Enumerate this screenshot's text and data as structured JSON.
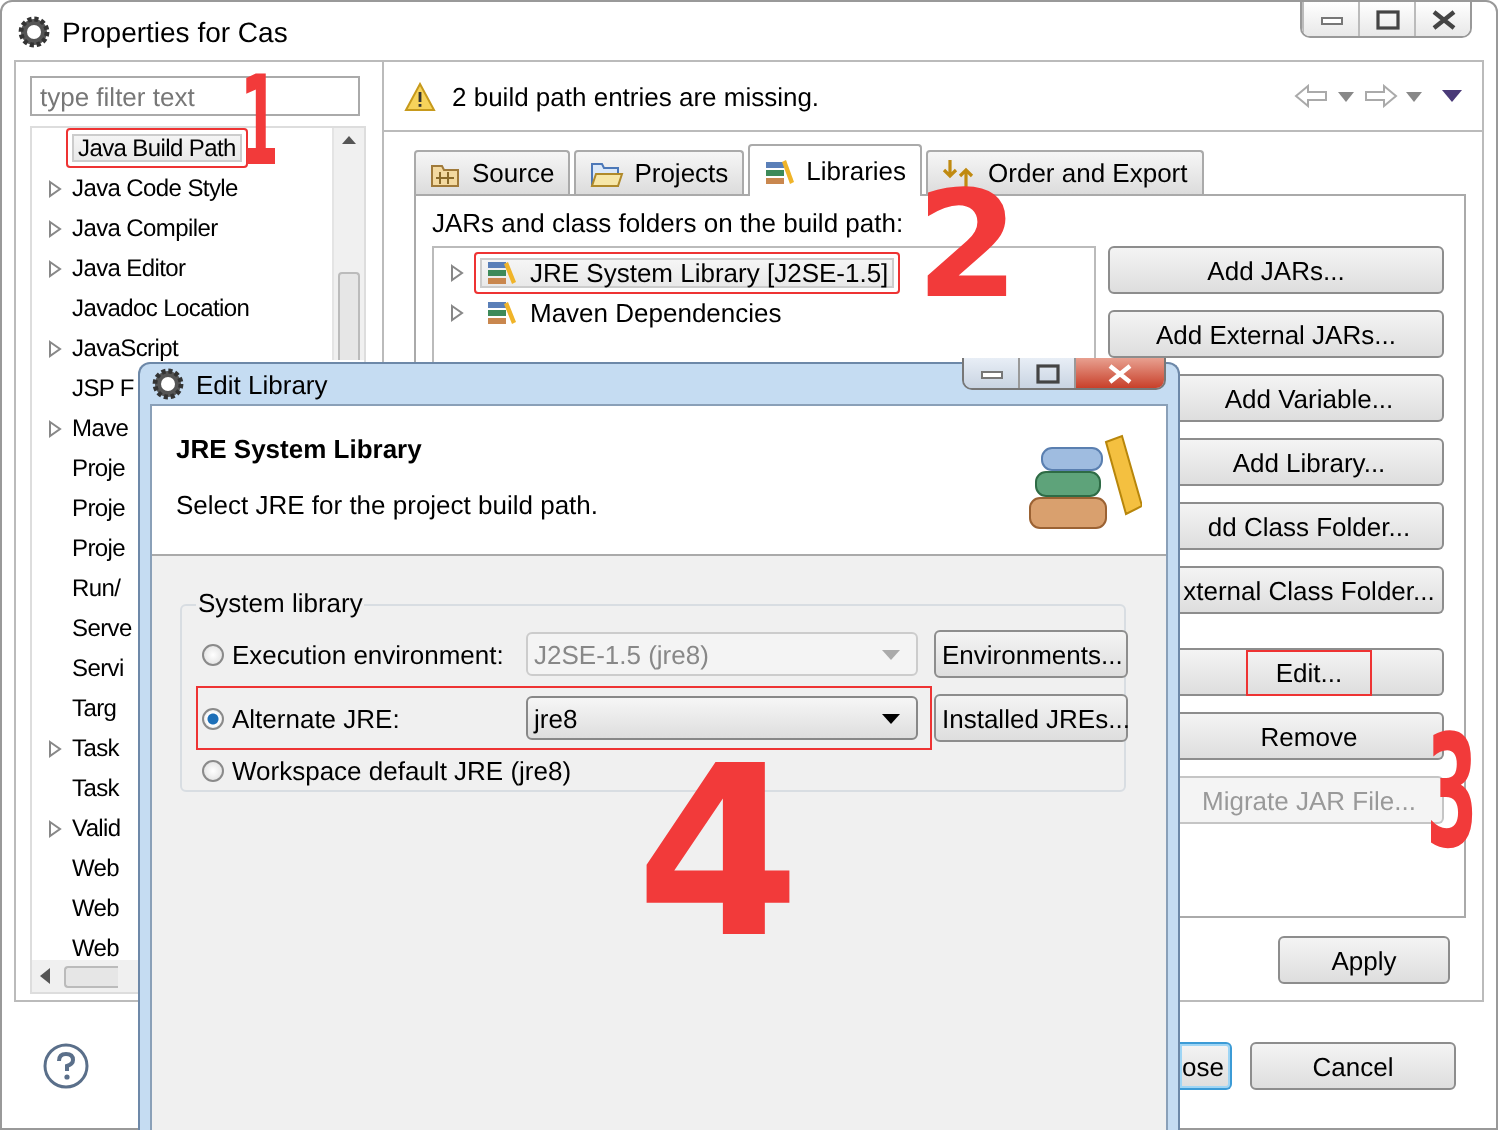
{
  "window": {
    "title": "Properties for Cas"
  },
  "sidebar": {
    "filter": {
      "placeholder": "type filter text"
    },
    "items": [
      {
        "label": "Java Build Path",
        "selected": true,
        "expandable": false,
        "highlighted": true
      },
      {
        "label": "Java Code Style",
        "selected": false,
        "expandable": true,
        "highlighted": false
      },
      {
        "label": "Java Compiler",
        "selected": false,
        "expandable": true,
        "highlighted": false
      },
      {
        "label": "Java Editor",
        "selected": false,
        "expandable": true,
        "highlighted": false
      },
      {
        "label": "Javadoc Location",
        "selected": false,
        "expandable": false,
        "highlighted": false
      },
      {
        "label": "JavaScript",
        "selected": false,
        "expandable": true,
        "highlighted": false
      },
      {
        "label": "JSP F",
        "selected": false,
        "expandable": false,
        "highlighted": false
      },
      {
        "label": "Mave",
        "selected": false,
        "expandable": true,
        "highlighted": false
      },
      {
        "label": "Proje",
        "selected": false,
        "expandable": false,
        "highlighted": false
      },
      {
        "label": "Proje",
        "selected": false,
        "expandable": false,
        "highlighted": false
      },
      {
        "label": "Proje",
        "selected": false,
        "expandable": false,
        "highlighted": false
      },
      {
        "label": "Run/",
        "selected": false,
        "expandable": false,
        "highlighted": false
      },
      {
        "label": "Serve",
        "selected": false,
        "expandable": false,
        "highlighted": false
      },
      {
        "label": "Servi",
        "selected": false,
        "expandable": false,
        "highlighted": false
      },
      {
        "label": "Targ",
        "selected": false,
        "expandable": false,
        "highlighted": false
      },
      {
        "label": "Task",
        "selected": false,
        "expandable": true,
        "highlighted": false
      },
      {
        "label": "Task",
        "selected": false,
        "expandable": false,
        "highlighted": false
      },
      {
        "label": "Valid",
        "selected": false,
        "expandable": true,
        "highlighted": false
      },
      {
        "label": "Web",
        "selected": false,
        "expandable": false,
        "highlighted": false
      },
      {
        "label": "Web",
        "selected": false,
        "expandable": false,
        "highlighted": false
      },
      {
        "label": "Web",
        "selected": false,
        "expandable": false,
        "highlighted": false
      }
    ]
  },
  "message": {
    "kind": "warning",
    "text": "2 build path entries are missing."
  },
  "tabs": [
    {
      "label": "Source",
      "kind": "source",
      "selected": false
    },
    {
      "label": "Projects",
      "kind": "projects",
      "selected": false
    },
    {
      "label": "Libraries",
      "kind": "libraries",
      "selected": true
    },
    {
      "label": "Order and Export",
      "kind": "order",
      "selected": false
    }
  ],
  "build_path": {
    "label": "JARs and class folders on the build path:",
    "entries": [
      {
        "label": "JRE System Library [J2SE-1.5]",
        "selected": true,
        "highlighted": true
      },
      {
        "label": "Maven Dependencies",
        "selected": false,
        "highlighted": false
      }
    ],
    "buttons": [
      {
        "label": "Add JARs...",
        "disabled": false,
        "highlighted": false
      },
      {
        "label": "Add External JARs...",
        "disabled": false,
        "highlighted": false
      },
      {
        "label": "Add Variable...",
        "disabled": false,
        "highlighted": false
      },
      {
        "label": "Add Library...",
        "disabled": false,
        "highlighted": false
      },
      {
        "label": "dd Class Folder...",
        "disabled": false,
        "highlighted": false
      },
      {
        "label": "xternal Class Folder...",
        "disabled": false,
        "highlighted": false
      },
      {
        "label": "Edit...",
        "disabled": false,
        "highlighted": true
      },
      {
        "label": "Remove",
        "disabled": false,
        "highlighted": false
      },
      {
        "label": "Migrate JAR File...",
        "disabled": true,
        "highlighted": false
      }
    ]
  },
  "apply_button": "Apply",
  "footer_buttons": [
    {
      "label": "ose",
      "default": true
    },
    {
      "label": "Cancel",
      "default": false
    }
  ],
  "dialog": {
    "title": "Edit Library",
    "heading": "JRE System Library",
    "description": "Select JRE for the project build path.",
    "group": {
      "title": "System library",
      "options": [
        {
          "kind": "combo",
          "label": "Execution environment:",
          "selected": false,
          "value": "J2SE-1.5 (jre8)",
          "disabled": true,
          "button": "Environments...",
          "highlighted": false
        },
        {
          "kind": "combo",
          "label": "Alternate JRE:",
          "selected": true,
          "value": "jre8",
          "disabled": false,
          "button": "Installed JREs...",
          "highlighted": true
        },
        {
          "kind": "plain",
          "label": "Workspace default JRE (jre8)",
          "selected": false,
          "highlighted": false
        }
      ]
    }
  },
  "annotations": [
    {
      "label": "1"
    },
    {
      "label": "2"
    },
    {
      "label": "3"
    },
    {
      "label": "4"
    }
  ]
}
